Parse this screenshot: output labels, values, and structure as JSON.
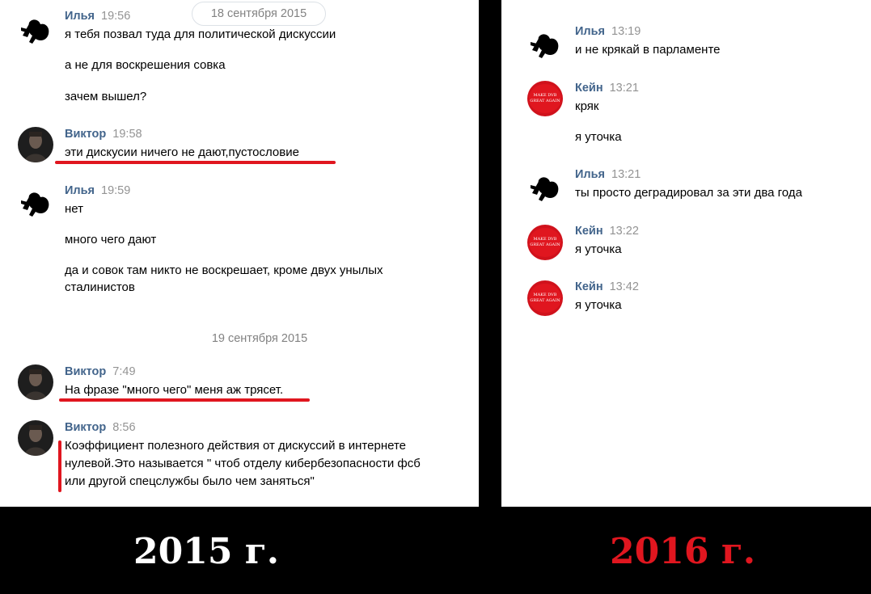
{
  "left": {
    "date_separator_1": "18 сентября 2015",
    "date_separator_2": "19 сентября 2015",
    "messages": [
      {
        "author": "Илья",
        "time": "19:56",
        "lines": [
          "я тебя позвал туда для политической дискуссии",
          "а не для воскрешения совка",
          "зачем вышел?"
        ]
      },
      {
        "author": "Виктор",
        "time": "19:58",
        "lines": [
          "эти дискусии ничего не дают,пустословие"
        ]
      },
      {
        "author": "Илья",
        "time": "19:59",
        "lines": [
          "нет",
          "много чего дают",
          "да и совок там никто не воскрешает, кроме двух унылых",
          "сталинистов"
        ]
      },
      {
        "author": "Виктор",
        "time": "7:49",
        "lines": [
          "На фразе \"много чего\" меня аж трясет."
        ]
      },
      {
        "author": "Виктор",
        "time": "8:56",
        "lines": [
          "Коэффициент полезного действия от дискуссий в интернете",
          "нулевой.Это называется \" чтоб отделу кибербезопасности фсб",
          "или другой спецслужбы было чем заняться\""
        ]
      }
    ]
  },
  "right": {
    "messages": [
      {
        "author": "Илья",
        "time": "13:19",
        "lines": [
          "и не крякай в парламенте"
        ]
      },
      {
        "author": "Кейн",
        "time": "13:21",
        "lines": [
          "кряк",
          "я уточка"
        ]
      },
      {
        "author": "Илья",
        "time": "13:21",
        "lines": [
          "ты просто деградировал за эти два года"
        ]
      },
      {
        "author": "Кейн",
        "time": "13:22",
        "lines": [
          "я уточка"
        ]
      },
      {
        "author": "Кейн",
        "time": "13:42",
        "lines": [
          "я уточка"
        ]
      }
    ]
  },
  "captions": {
    "year_left": "2015 г.",
    "year_right": "2016 г."
  },
  "colors": {
    "author": "#42648b",
    "time": "#939393",
    "highlight": "#e0161f",
    "year_right": "#e0161f"
  }
}
